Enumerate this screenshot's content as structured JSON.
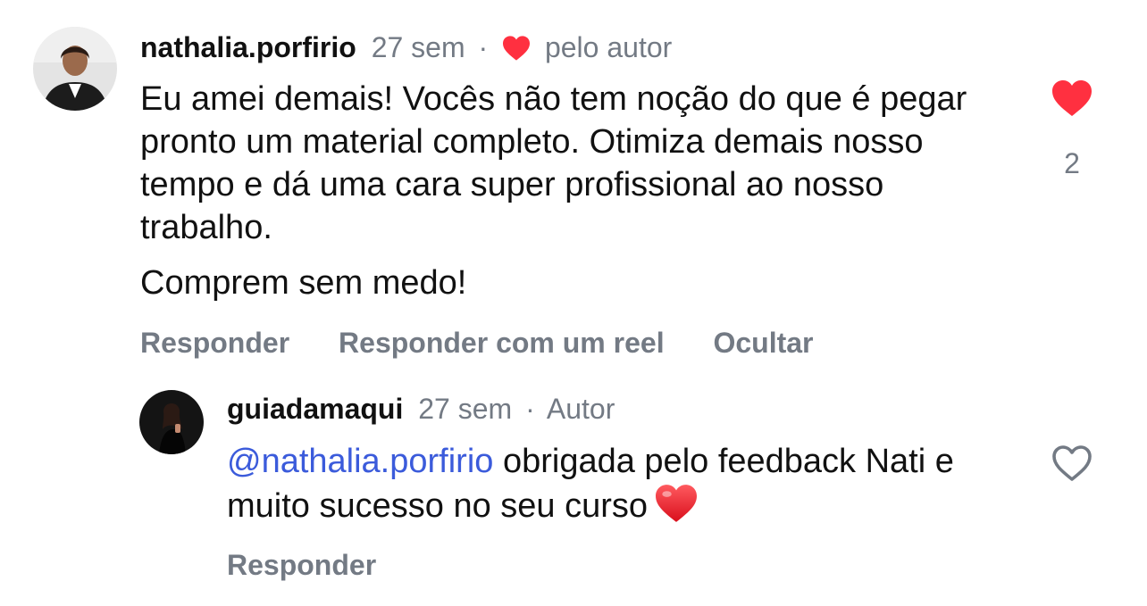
{
  "comment": {
    "username": "nathalia.porfirio",
    "time": "27 sem",
    "separator": "·",
    "liked_by_author_label": "pelo autor",
    "paragraph_1": "Eu amei demais! Vocês não tem noção do que é pegar pronto um material completo. Otimiza demais nosso tempo e dá uma cara super profissional ao nosso trabalho.",
    "paragraph_2": "Comprem sem medo!",
    "like_count": "2",
    "liked": true,
    "actions": {
      "reply": "Responder",
      "reply_reel": "Responder com um reel",
      "hide": "Ocultar"
    }
  },
  "reply": {
    "username": "guiadamaqui",
    "time": "27 sem",
    "separator": "·",
    "badge": "Autor",
    "mention": "@nathalia.porfirio",
    "text": " obrigada pelo feedback Nati e muito sucesso no seu curso",
    "liked": false,
    "actions": {
      "reply": "Responder"
    }
  },
  "colors": {
    "like_red": "#ff3040",
    "secondary_text": "#737a84",
    "mention_blue": "#3b5bdb"
  },
  "icons": {
    "liked_heart": "heart-filled-icon",
    "unliked_heart": "heart-outline-icon",
    "author_heart": "heart-small-icon",
    "reply_emoji": "red-heart-emoji"
  }
}
